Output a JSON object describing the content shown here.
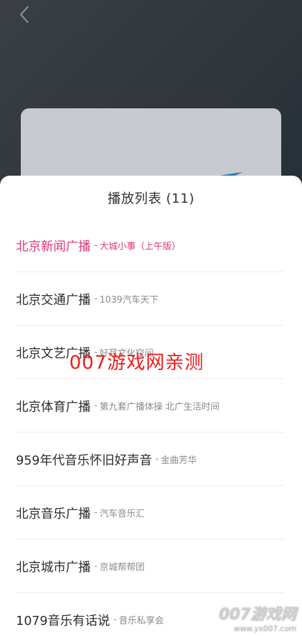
{
  "header": {
    "back_icon": "chevron-left-icon"
  },
  "playlist": {
    "title": "播放列表 (11)",
    "items": [
      {
        "title": "北京新闻广播",
        "separator": "-",
        "subtitle": "大城小事（上午版）",
        "active": true
      },
      {
        "title": "北京交通广播",
        "separator": "-",
        "subtitle": "1039汽车天下",
        "active": false
      },
      {
        "title": "北京文艺广播",
        "separator": "-",
        "subtitle": "好耳文化空间",
        "active": false
      },
      {
        "title": "北京体育广播",
        "separator": "-",
        "subtitle": "第九套广播体操 北广生活时间",
        "active": false
      },
      {
        "title": "959年代音乐怀旧好声音",
        "separator": "-",
        "subtitle": "金曲芳华",
        "active": false
      },
      {
        "title": "北京音乐广播",
        "separator": "-",
        "subtitle": "汽车音乐汇",
        "active": false
      },
      {
        "title": "北京城市广播",
        "separator": "-",
        "subtitle": "京城帮帮团",
        "active": false
      },
      {
        "title": "1079音乐有话说",
        "separator": "-",
        "subtitle": "音乐私享会",
        "active": false
      }
    ]
  },
  "watermarks": {
    "overlay_text": "007游戏网亲测",
    "corner_logo": "007游戏网",
    "corner_url": "www.yx007.com"
  },
  "colors": {
    "active": "#e2367a",
    "watermark": "#ee1c1c"
  }
}
